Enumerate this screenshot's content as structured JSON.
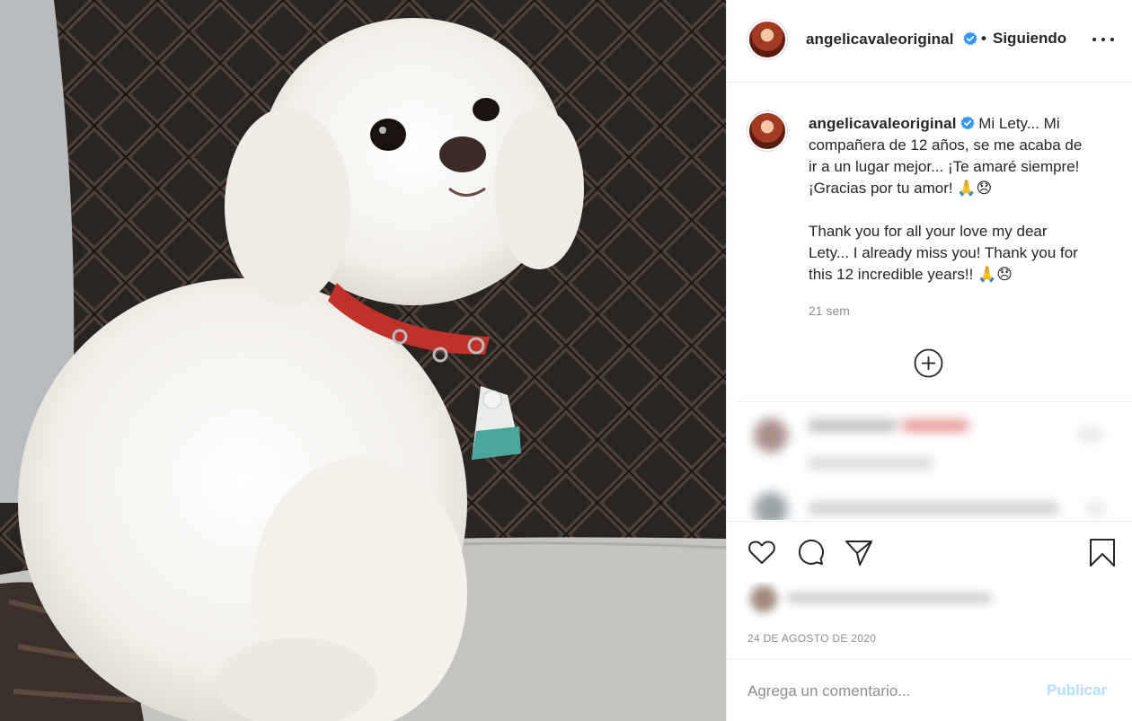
{
  "post": {
    "username": "angelicavaleoriginal",
    "separator": "•",
    "follow_status": "Siguiendo",
    "image_icon": "photo-dog"
  },
  "caption": {
    "username": "angelicavaleoriginal",
    "paragraph_1": "Mi Lety... Mi compañera de 12 años, se me acaba de ir a un lugar mejor... ¡Te amaré siempre! ¡Gracias por tu amor! 🙏😞",
    "paragraph_2": "Thank you for all your love my dear Lety... I already miss you! Thank you for this 12 incredible years!! 🙏😞",
    "time_ago": "21 sem"
  },
  "meta": {
    "date": "24 DE AGOSTO DE 2020"
  },
  "comment_box": {
    "placeholder": "Agrega un comentario...",
    "publish_label": "Publicar"
  },
  "icons": {
    "verified": "verified-badge-icon",
    "more": "more-options-icon",
    "load_more": "plus-circle-icon",
    "like": "heart-icon",
    "comment": "comment-icon",
    "share": "paper-plane-icon",
    "save": "bookmark-icon"
  },
  "colors": {
    "verified_blue": "#3897f0",
    "publish_disabled": "#b2dffc",
    "muted_text": "#8e8e8e"
  }
}
